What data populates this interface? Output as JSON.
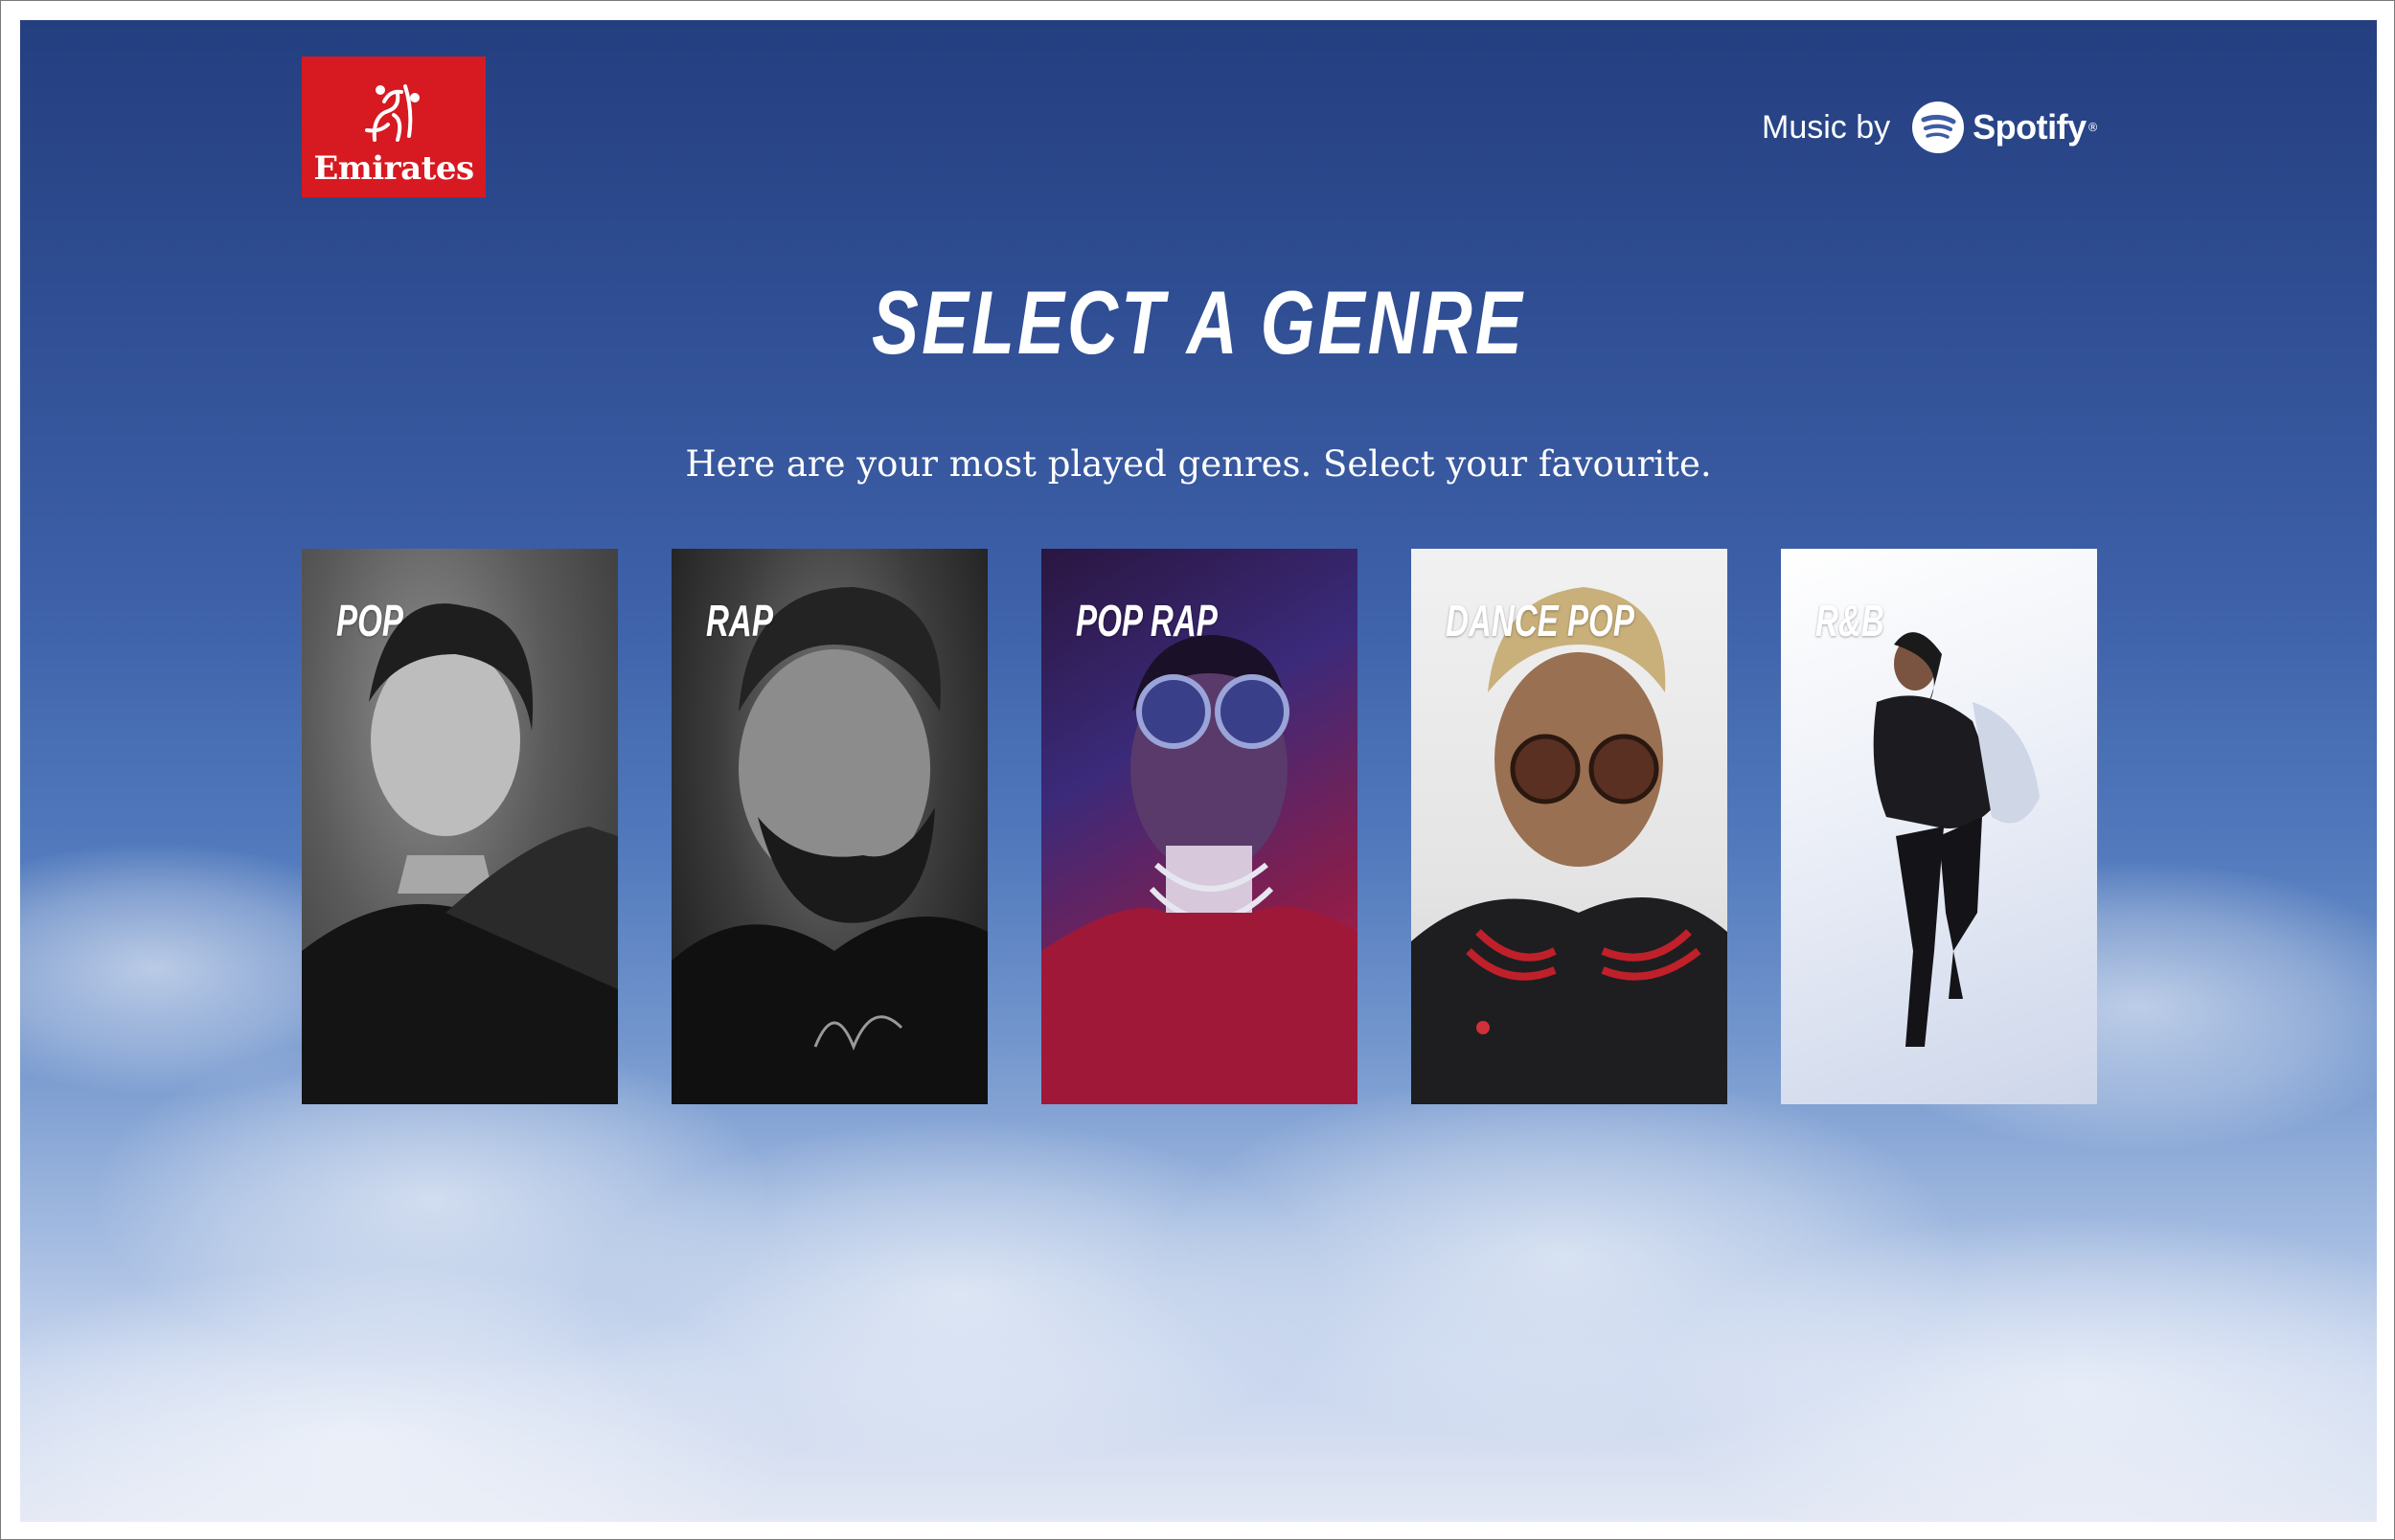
{
  "brand": {
    "airline": "Emirates",
    "music_by_label": "Music by",
    "partner": "Spotify",
    "brand_red": "#d71921",
    "partner_icon": "spotify-icon"
  },
  "page": {
    "title": "SELECT A GENRE",
    "subtitle": "Here are your most played genres. Select your favourite."
  },
  "genres": [
    {
      "label": "POP"
    },
    {
      "label": "RAP"
    },
    {
      "label": "POP RAP"
    },
    {
      "label": "DANCE POP"
    },
    {
      "label": "R&B"
    }
  ],
  "colors": {
    "sky_top": "#243f80",
    "sky_bottom": "#e3e8f4",
    "text": "#ffffff"
  }
}
